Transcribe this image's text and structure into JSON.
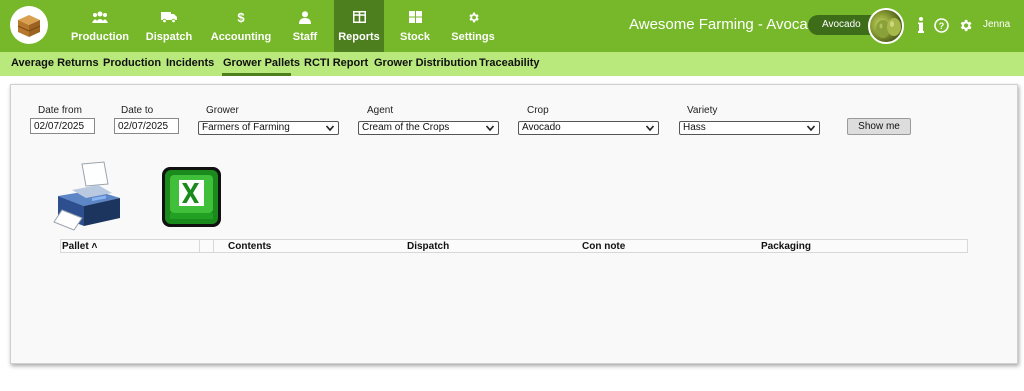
{
  "nav": {
    "items": [
      {
        "label": "Production",
        "icon": "users-icon"
      },
      {
        "label": "Dispatch",
        "icon": "truck-icon"
      },
      {
        "label": "Accounting",
        "icon": "dollar-icon"
      },
      {
        "label": "Staff",
        "icon": "person-icon"
      },
      {
        "label": "Reports",
        "icon": "report-icon",
        "active": true
      },
      {
        "label": "Stock",
        "icon": "grid-icon"
      },
      {
        "label": "Settings",
        "icon": "gear-icon"
      }
    ]
  },
  "header": {
    "title": "Awesome Farming - Avocados",
    "crop_pill": "Avocado",
    "user": "Jenna"
  },
  "subnav": {
    "items": [
      "Average Returns",
      "Production",
      "Incidents",
      "Grower Pallets",
      "RCTI Report",
      "Grower Distribution",
      "Traceability"
    ],
    "active": "Grower Pallets"
  },
  "filters": {
    "date_from_label": "Date from",
    "date_from": "02/07/2025",
    "date_to_label": "Date to",
    "date_to": "02/07/2025",
    "grower_label": "Grower",
    "grower": "Farmers of Farming",
    "agent_label": "Agent",
    "agent": "Cream of the Crops",
    "crop_label": "Crop",
    "crop": "Avocado",
    "variety_label": "Variety",
    "variety": "Hass",
    "show_button": "Show me"
  },
  "table": {
    "columns": [
      "Pallet ˄",
      "Contents",
      "Dispatch",
      "Con note",
      "Packaging"
    ]
  },
  "colors": {
    "topbar": "#77b82a",
    "active_nav": "#4d7f1f",
    "subnav": "#b9e87c"
  }
}
